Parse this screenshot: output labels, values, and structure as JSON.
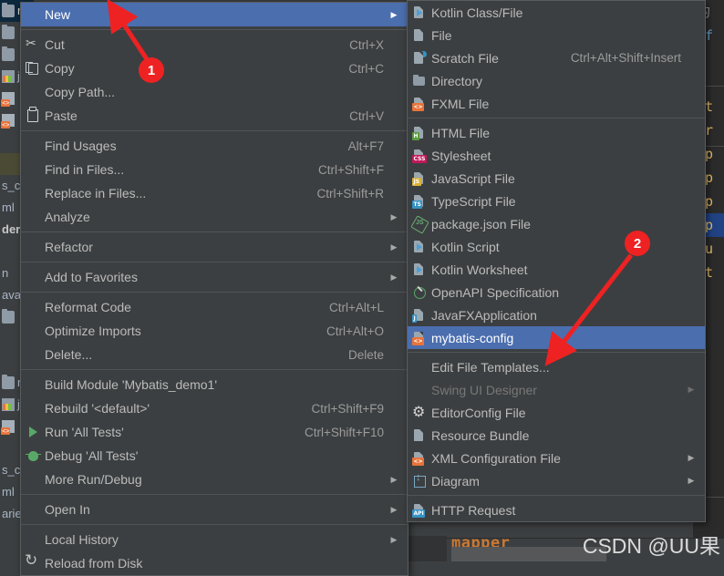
{
  "app": {
    "title": "IntelliJ IDEA context menu — New submenu",
    "accent_selection": "#4b6eaf",
    "menu_bg": "#3c3f41",
    "menu_border": "#5a5d5f",
    "text_color": "#bbbbbb",
    "shortcut_color": "#9b9b9b",
    "badge_color": "#ee2222",
    "arrow_color": "#ee2222"
  },
  "context_menu": {
    "items": [
      {
        "label": "New",
        "shortcut": "",
        "icon": "",
        "submenu": true,
        "selected": true,
        "disabled": false
      },
      {
        "separator": true
      },
      {
        "label": "Cut",
        "shortcut": "Ctrl+X",
        "icon": "scissors-icon",
        "submenu": false
      },
      {
        "label": "Copy",
        "shortcut": "Ctrl+C",
        "icon": "copy-icon",
        "submenu": false
      },
      {
        "label": "Copy Path...",
        "shortcut": "",
        "icon": "",
        "submenu": false
      },
      {
        "label": "Paste",
        "shortcut": "Ctrl+V",
        "icon": "clipboard-icon",
        "submenu": false
      },
      {
        "separator": true
      },
      {
        "label": "Find Usages",
        "shortcut": "Alt+F7",
        "icon": "",
        "submenu": false
      },
      {
        "label": "Find in Files...",
        "shortcut": "Ctrl+Shift+F",
        "icon": "",
        "submenu": false
      },
      {
        "label": "Replace in Files...",
        "shortcut": "Ctrl+Shift+R",
        "icon": "",
        "submenu": false
      },
      {
        "label": "Analyze",
        "shortcut": "",
        "icon": "",
        "submenu": true
      },
      {
        "separator": true
      },
      {
        "label": "Refactor",
        "shortcut": "",
        "icon": "",
        "submenu": true
      },
      {
        "separator": true
      },
      {
        "label": "Add to Favorites",
        "shortcut": "",
        "icon": "",
        "submenu": true
      },
      {
        "separator": true
      },
      {
        "label": "Reformat Code",
        "shortcut": "Ctrl+Alt+L",
        "icon": "",
        "submenu": false
      },
      {
        "label": "Optimize Imports",
        "shortcut": "Ctrl+Alt+O",
        "icon": "",
        "submenu": false
      },
      {
        "label": "Delete...",
        "shortcut": "Delete",
        "icon": "",
        "submenu": false
      },
      {
        "separator": true
      },
      {
        "label": "Build Module 'Mybatis_demo1'",
        "shortcut": "",
        "icon": "",
        "submenu": false
      },
      {
        "label": "Rebuild '<default>'",
        "shortcut": "Ctrl+Shift+F9",
        "icon": "",
        "submenu": false
      },
      {
        "label": "Run 'All Tests'",
        "shortcut": "Ctrl+Shift+F10",
        "icon": "run-play-icon",
        "submenu": false
      },
      {
        "label": "Debug 'All Tests'",
        "shortcut": "",
        "icon": "debug-bug-icon",
        "submenu": false
      },
      {
        "label": "More Run/Debug",
        "shortcut": "",
        "icon": "",
        "submenu": true
      },
      {
        "separator": true
      },
      {
        "label": "Open In",
        "shortcut": "",
        "icon": "",
        "submenu": true
      },
      {
        "separator": true
      },
      {
        "label": "Local History",
        "shortcut": "",
        "icon": "",
        "submenu": true
      },
      {
        "label": "Reload from Disk",
        "shortcut": "",
        "icon": "reload-icon",
        "submenu": false
      }
    ]
  },
  "new_submenu": {
    "items": [
      {
        "label": "Kotlin Class/File",
        "shortcut": "",
        "icon": "kotlin-file-icon"
      },
      {
        "label": "File",
        "shortcut": "",
        "icon": "file-icon"
      },
      {
        "label": "Scratch File",
        "shortcut": "Ctrl+Alt+Shift+Insert",
        "icon": "scratch-file-icon"
      },
      {
        "label": "Directory",
        "shortcut": "",
        "icon": "directory-icon"
      },
      {
        "label": "FXML File",
        "shortcut": "",
        "icon": "fxml-file-icon",
        "badge": "<>",
        "badge_color": "#e8743b"
      },
      {
        "separator": true
      },
      {
        "label": "HTML File",
        "shortcut": "",
        "icon": "html-file-icon",
        "badge": "H",
        "badge_color": "#5a9c3f"
      },
      {
        "label": "Stylesheet",
        "shortcut": "",
        "icon": "css-file-icon",
        "badge": "CSS",
        "badge_color": "#c2185b"
      },
      {
        "label": "JavaScript File",
        "shortcut": "",
        "icon": "javascript-file-icon",
        "badge": "JS",
        "badge_color": "#d9b03a"
      },
      {
        "label": "TypeScript File",
        "shortcut": "",
        "icon": "typescript-file-icon",
        "badge": "TS",
        "badge_color": "#3592c4"
      },
      {
        "label": "package.json File",
        "shortcut": "",
        "icon": "nodejs-icon"
      },
      {
        "label": "Kotlin Script",
        "shortcut": "",
        "icon": "kotlin-script-icon"
      },
      {
        "label": "Kotlin Worksheet",
        "shortcut": "",
        "icon": "kotlin-worksheet-icon"
      },
      {
        "label": "OpenAPI Specification",
        "shortcut": "",
        "icon": "openapi-icon"
      },
      {
        "label": "JavaFXApplication",
        "shortcut": "",
        "icon": "javafx-file-icon",
        "badge": "J",
        "badge_color": "#3592c4"
      },
      {
        "label": "mybatis-config",
        "shortcut": "",
        "icon": "xml-file-icon",
        "badge": "<>",
        "badge_color": "#e8743b",
        "selected": true
      },
      {
        "separator": true
      },
      {
        "label": "Edit File Templates...",
        "shortcut": "",
        "icon": ""
      },
      {
        "label": "Swing UI Designer",
        "shortcut": "",
        "icon": "",
        "submenu": true,
        "disabled": true
      },
      {
        "label": "EditorConfig File",
        "shortcut": "",
        "icon": "gear-icon"
      },
      {
        "label": "Resource Bundle",
        "shortcut": "",
        "icon": "resource-bundle-icon"
      },
      {
        "label": "XML Configuration File",
        "shortcut": "",
        "icon": "xml-config-icon",
        "badge": "<>",
        "badge_color": "#e8743b",
        "submenu": true
      },
      {
        "label": "Diagram",
        "shortcut": "",
        "icon": "diagram-icon",
        "submenu": true
      },
      {
        "separator": true
      },
      {
        "label": "HTTP Request",
        "shortcut": "",
        "icon": "http-request-icon",
        "badge": "API",
        "badge_color": "#3592c4"
      }
    ]
  },
  "annotations": {
    "badges": [
      {
        "id": "1",
        "label": "1"
      },
      {
        "id": "2",
        "label": "2"
      }
    ]
  },
  "project_tree": {
    "items": [
      {
        "label": "reso",
        "icon": "folder-icon",
        "selected": true
      },
      {
        "label": "",
        "icon": "folder-icon"
      },
      {
        "label": "",
        "icon": "folder-icon"
      },
      {
        "label": "j",
        "icon": "resource-bundle-icon"
      },
      {
        "label": "",
        "icon": "xml-file-icon"
      },
      {
        "label": "",
        "icon": "xml-file-icon"
      },
      {
        "label": "",
        "icon": ""
      },
      {
        "label": "",
        "icon": "",
        "highlight": "olive"
      },
      {
        "label": "s_c",
        "icon": ""
      },
      {
        "label": "ml",
        "icon": ""
      },
      {
        "label": "der",
        "icon": "",
        "bold": true
      },
      {
        "label": "",
        "icon": ""
      },
      {
        "label": "n",
        "icon": ""
      },
      {
        "label": "ava",
        "icon": ""
      },
      {
        "label": "",
        "icon": "folder-icon"
      },
      {
        "label": "",
        "icon": ""
      },
      {
        "label": "",
        "icon": ""
      },
      {
        "label": "reso",
        "icon": "folder-icon"
      },
      {
        "label": "j",
        "icon": "resource-bundle-icon"
      },
      {
        "label": "",
        "icon": "xml-file-icon"
      },
      {
        "label": "",
        "icon": ""
      },
      {
        "label": "s_c",
        "icon": ""
      },
      {
        "label": "ml",
        "icon": ""
      },
      {
        "label": "arie",
        "icon": ""
      }
    ]
  },
  "editor": {
    "lines": [
      {
        "text": "的",
        "color": "gray"
      },
      {
        "text": "ef",
        "color": "blue"
      },
      {
        "text": "t",
        "color": "orange"
      },
      {
        "text": "",
        "color": "gray"
      },
      {
        "text": "ct",
        "color": "gold"
      },
      {
        "text": "ur",
        "color": "gold"
      },
      {
        "text": "op",
        "color": "gold"
      },
      {
        "text": "op",
        "color": "gold"
      },
      {
        "text": "op",
        "color": "gold"
      },
      {
        "text": "op",
        "color": "gold",
        "selected": true
      },
      {
        "text": "ou",
        "color": "gold"
      },
      {
        "text": "nt",
        "color": "gold"
      },
      {
        "text": "",
        "color": "gray"
      },
      {
        "text": ">",
        "color": "gray"
      }
    ],
    "bottom_tag": "mapper"
  },
  "watermark": {
    "text": "CSDN @UU果"
  }
}
